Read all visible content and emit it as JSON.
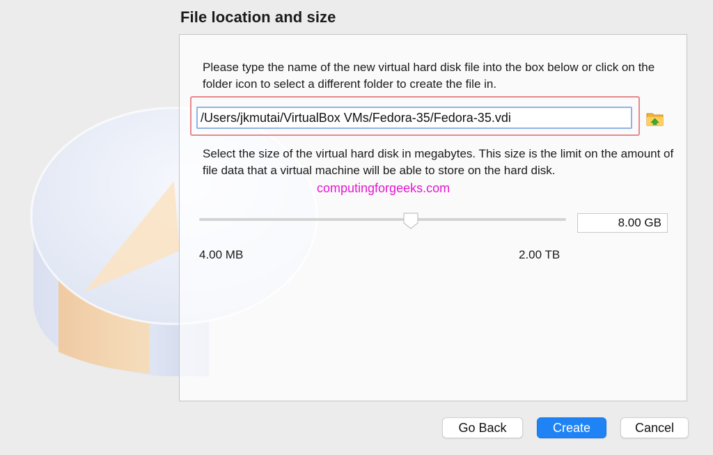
{
  "wizard": {
    "title": "File location and size"
  },
  "location": {
    "description": "Please type the name of the new virtual hard disk file into the box below or click on the folder icon to select a different folder to create the file in.",
    "path_value": "/Users/jkmutai/VirtualBox VMs/Fedora-35/Fedora-35.vdi",
    "folder_icon": "folder-browse-icon"
  },
  "size": {
    "description": "Select the size of the virtual hard disk in megabytes. This size is the limit on the amount of file data that a virtual machine will be able to store on the hard disk.",
    "value": "8.00 GB",
    "min_label": "4.00 MB",
    "max_label": "2.00 TB"
  },
  "watermark": "computingforgeeks.com",
  "buttons": {
    "back": "Go Back",
    "create": "Create",
    "cancel": "Cancel"
  },
  "colors": {
    "accent": "#1f83f6",
    "highlight": "#e8888c",
    "watermark": "#e516d2"
  }
}
